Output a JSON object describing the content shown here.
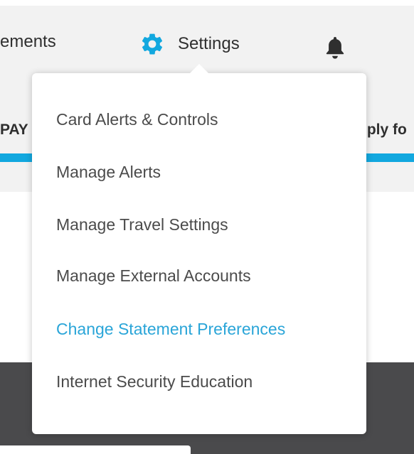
{
  "nav": {
    "statements_label": "ements",
    "settings_label": "Settings",
    "settings_icon": "gear-icon",
    "bell_icon": "bell-icon",
    "accent_color": "#12a8df"
  },
  "subnav": {
    "left_label": "PAY",
    "right_label": "pply fo"
  },
  "settings_menu": {
    "items": [
      {
        "label": "Card Alerts & Controls"
      },
      {
        "label": "Manage Alerts"
      },
      {
        "label": "Manage Travel Settings"
      },
      {
        "label": "Manage External Accounts"
      },
      {
        "label": "Change Statement Preferences",
        "active": true,
        "color": "#2aa5d8"
      },
      {
        "label": "Internet Security Education"
      }
    ]
  }
}
